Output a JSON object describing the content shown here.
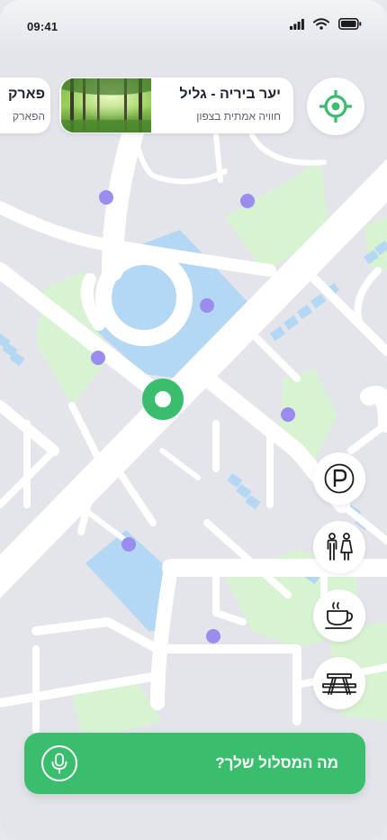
{
  "status_bar": {
    "time": "09:41"
  },
  "places": [
    {
      "title": "יער ביריה - גליל",
      "subtitle": "חוויה אמתית בצפון"
    },
    {
      "title": "פארק",
      "subtitle": "הפארק"
    }
  ],
  "poi_buttons": [
    "parking-icon",
    "restroom-icon",
    "coffee-icon",
    "picnic-table-icon"
  ],
  "route_bar": {
    "label": "מה המסלול שלך?"
  },
  "colors": {
    "accent": "#3bbd6e",
    "poi_marker": "#9b8cf0",
    "park": "#d8f3d2",
    "water": "#b4d7f3",
    "road": "#ffffff",
    "map_background": "#e3e5eb"
  }
}
